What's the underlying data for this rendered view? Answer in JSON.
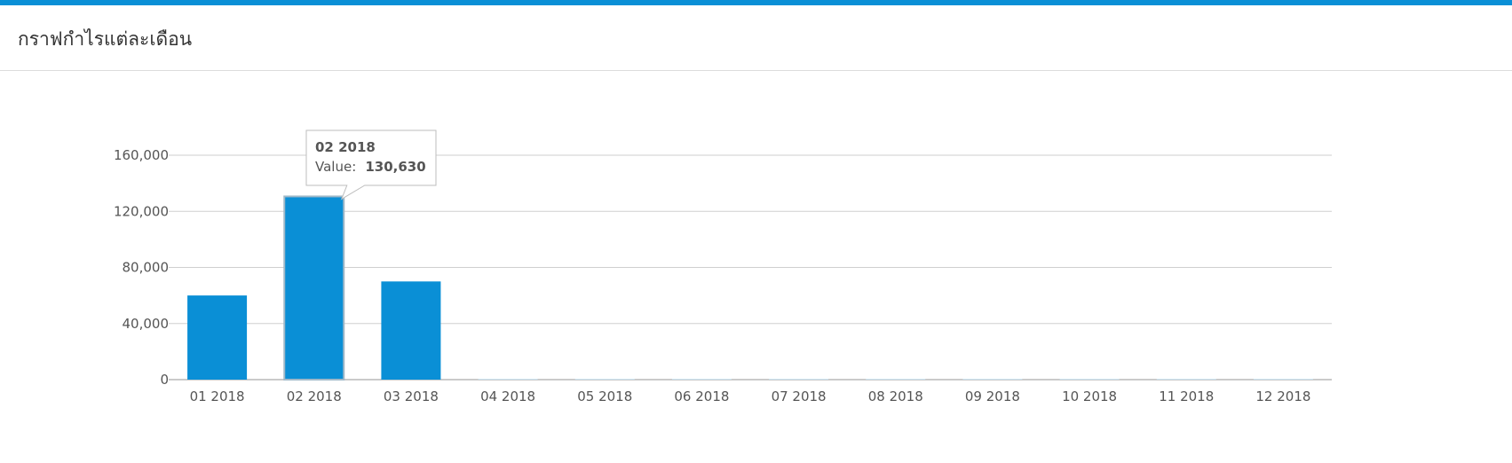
{
  "header": {
    "title": "กราฟกำไรแต่ละเดือน"
  },
  "colors": {
    "accent": "#0a8fd6",
    "bar": "#0a8fd6"
  },
  "chart_data": {
    "type": "bar",
    "categories": [
      "01 2018",
      "02 2018",
      "03 2018",
      "04 2018",
      "05 2018",
      "06 2018",
      "07 2018",
      "08 2018",
      "09 2018",
      "10 2018",
      "11 2018",
      "12 2018"
    ],
    "values": [
      60000,
      130630,
      70000,
      0,
      0,
      0,
      0,
      0,
      0,
      0,
      0,
      0
    ],
    "ylim": [
      0,
      160000
    ],
    "yticks": [
      0,
      40000,
      80000,
      120000,
      160000
    ],
    "ytick_labels": [
      "0",
      "40,000",
      "80,000",
      "120,000",
      "160,000"
    ],
    "grid": true,
    "tooltip": {
      "category": "02 2018",
      "label": "Value:",
      "value": "130,630",
      "index": 1
    }
  }
}
